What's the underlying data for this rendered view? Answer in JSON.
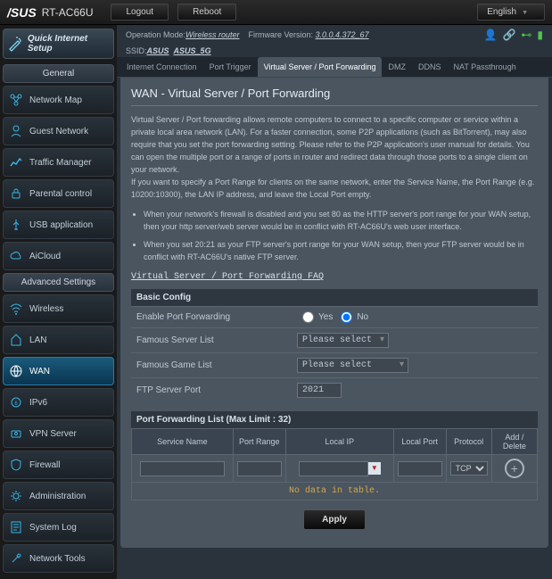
{
  "top": {
    "brand": "/SUS",
    "model": "RT-AC66U",
    "logout": "Logout",
    "reboot": "Reboot",
    "language": "English"
  },
  "info": {
    "op_mode_lbl": "Operation Mode: ",
    "op_mode": "Wireless router",
    "fw_lbl": "    Firmware Version: ",
    "fw": "3.0.0.4.372_67",
    "ssid_lbl": "SSID: ",
    "ssid1": "ASUS",
    "ssid2": "ASUS_5G"
  },
  "sidebar": {
    "qis": "Quick Internet Setup",
    "general": "General",
    "items_general": [
      "Network Map",
      "Guest Network",
      "Traffic Manager",
      "Parental control",
      "USB application",
      "AiCloud"
    ],
    "advanced": "Advanced Settings",
    "items_adv": [
      "Wireless",
      "LAN",
      "WAN",
      "IPv6",
      "VPN Server",
      "Firewall",
      "Administration",
      "System Log",
      "Network Tools"
    ]
  },
  "tabs": [
    "Internet Connection",
    "Port Trigger",
    "Virtual Server / Port Forwarding",
    "DMZ",
    "DDNS",
    "NAT Passthrough"
  ],
  "active_tab": 2,
  "page": {
    "title": "WAN - Virtual Server / Port Forwarding",
    "desc": "Virtual Server / Port forwarding allows remote computers to connect to a specific computer or service within a private local area network (LAN). For a faster connection, some P2P applications (such as BitTorrent), may also require that you set the port forwarding setting. Please refer to the P2P application's user manual for details. You can open the multiple port or a range of ports in router and redirect data through those ports to a single client on your network.\nIf you want to specify a Port Range for clients on the same network, enter the Service Name, the Port Range (e.g. 10200:10300), the LAN IP address, and leave the Local Port empty.",
    "bullet1": "When your network's firewall is disabled and you set 80 as the HTTP server's port range for your WAN setup, then your http server/web server would be in conflict with RT-AC66U's web user interface.",
    "bullet2": "When you set 20:21 as your FTP server's port range for your WAN setup, then your FTP server would be in conflict with RT-AC66U's native FTP server.",
    "faq": "Virtual Server / Port Forwarding FAQ"
  },
  "cfg": {
    "hdr": "Basic Config",
    "enable_lbl": "Enable Port Forwarding",
    "yes": "Yes",
    "no": "No",
    "famous_server_lbl": "Famous Server List",
    "famous_server_val": "Please select",
    "famous_game_lbl": "Famous Game List",
    "famous_game_val": "Please select",
    "ftp_lbl": "FTP Server Port",
    "ftp_val": "2021"
  },
  "pf": {
    "hdr": "Port Forwarding List (Max Limit : 32)",
    "cols": [
      "Service Name",
      "Port Range",
      "Local IP",
      "Local Port",
      "Protocol",
      "Add / Delete"
    ],
    "protocol": "TCP",
    "no_data": "No data in table.",
    "apply": "Apply"
  }
}
